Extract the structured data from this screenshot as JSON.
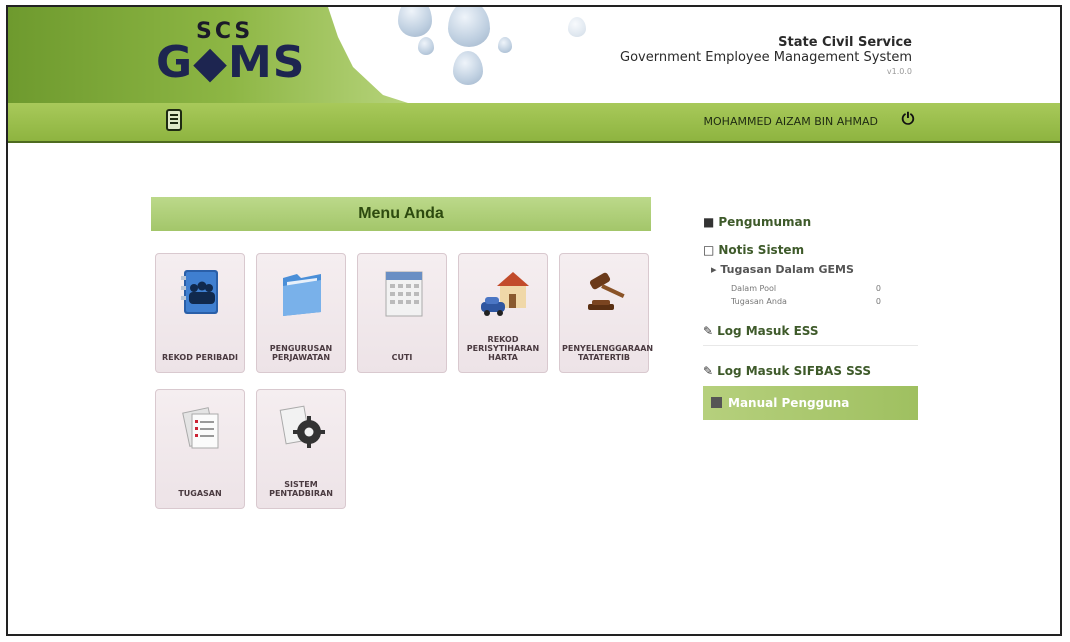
{
  "header": {
    "logo_top": "SCS",
    "logo_main": "G◆MS",
    "system_line1": "State Civil Service",
    "system_line2": "Government Employee Management System",
    "version": "v1.0.0"
  },
  "userbar": {
    "username": "MOHAMMED AIZAM BIN AHMAD",
    "menu_icon": "notepad-icon",
    "power_icon": "power-icon"
  },
  "menu": {
    "title": "Menu Anda",
    "tiles": [
      {
        "label": "REKOD PERIBADI",
        "icon": "contacts-book-icon"
      },
      {
        "label": "PENGURUSAN PERJAWATAN",
        "icon": "folder-icon"
      },
      {
        "label": "CUTI",
        "icon": "calendar-icon"
      },
      {
        "label": "REKOD PERISYTIHARAN HARTA",
        "icon": "house-car-icon"
      },
      {
        "label": "PENYELENGGARAAN TATATERTIB",
        "icon": "gavel-icon"
      },
      {
        "label": "TUGASAN",
        "icon": "task-document-icon"
      },
      {
        "label": "SISTEM PENTADBIRAN",
        "icon": "gear-document-icon"
      }
    ]
  },
  "right": {
    "announcement": "Pengumuman",
    "notice": "Notis Sistem",
    "tasks_heading": "Tugasan Dalam GEMS",
    "tasks": [
      {
        "label": "Dalam Pool",
        "value": "0"
      },
      {
        "label": "Tugasan Anda",
        "value": "0"
      }
    ],
    "ess_login": "Log Masuk ESS",
    "sifbas_login": "Log Masuk SIFBAS SSS",
    "manual": "Manual Pengguna"
  },
  "colors": {
    "brand_green": "#8db644",
    "dark_green": "#2d4a0f",
    "tile_bg": "#f5eef0"
  }
}
